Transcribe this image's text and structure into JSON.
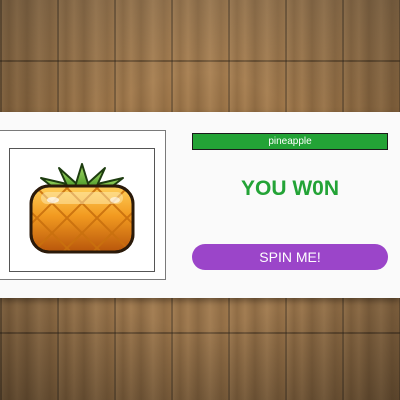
{
  "slot": {
    "symbol_icon": "pineapple-icon",
    "symbol_name": "pineapple"
  },
  "result_text": "YOU W0N",
  "spin_button": {
    "label": "SPIN ME!"
  },
  "colors": {
    "accent_green": "#23a336",
    "button_purple": "#9b45c9",
    "card_bg": "#fafafa"
  }
}
